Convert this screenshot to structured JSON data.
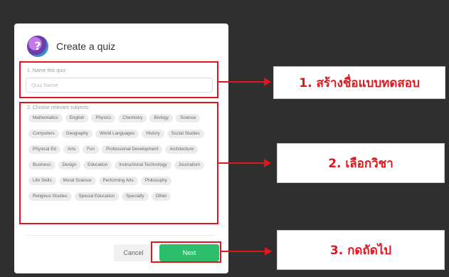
{
  "dialog": {
    "title": "Create a quiz",
    "name_section_label": "1. Name this quiz",
    "name_input_placeholder": "Quiz Name",
    "subjects_section_label": "2. Choose relevant subjects",
    "subjects": [
      "Mathematics",
      "English",
      "Physics",
      "Chemistry",
      "Biology",
      "Science",
      "Computers",
      "Geography",
      "World Languages",
      "History",
      "Social Studies",
      "Physical Ed",
      "Arts",
      "Fun",
      "Professional Development",
      "Architecture",
      "Business",
      "Design",
      "Education",
      "Instructional Technology",
      "Journalism",
      "Life Skills",
      "Moral Science",
      "Performing Arts",
      "Philosophy",
      "Religious Studies",
      "Special Education",
      "Specialty",
      "Other"
    ],
    "cancel_label": "Cancel",
    "next_label": "Next"
  },
  "callouts": {
    "step1": "1. สร้างชื่อแบบทดสอบ",
    "step2": "2. เลือกวิชา",
    "step3": "3. กดถัดไป"
  },
  "colors": {
    "background": "#2f2f2f",
    "highlight": "#e3141b",
    "next_button": "#2ebd6b"
  }
}
